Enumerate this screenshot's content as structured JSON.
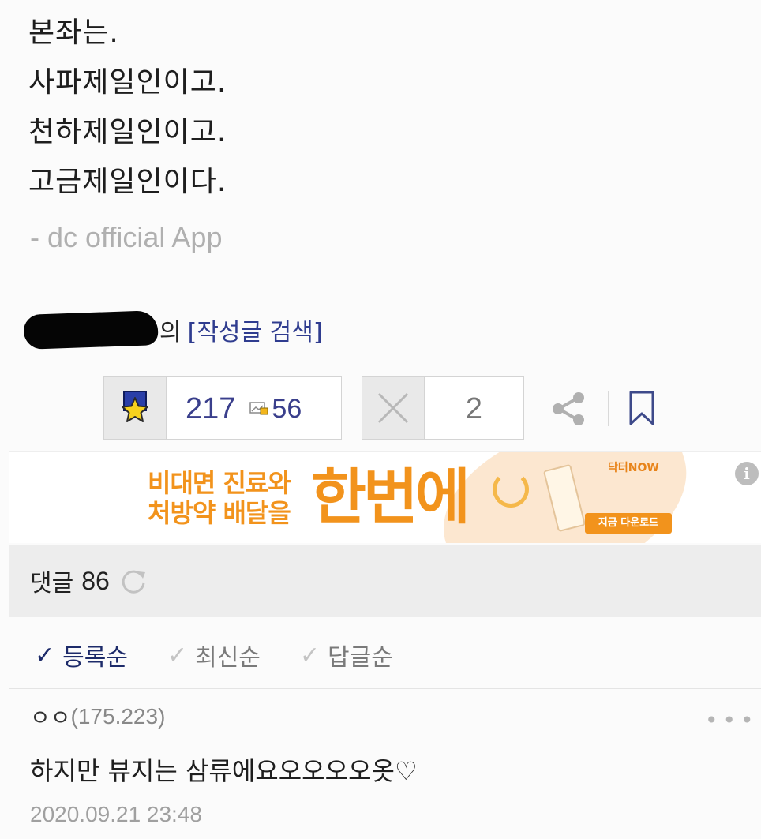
{
  "post": {
    "lines": [
      "본좌는.",
      "사파제일인이고.",
      "천하제일인이고.",
      "고금제일인이다."
    ],
    "signature": "- dc official App"
  },
  "author": {
    "suffix": "의",
    "search_link": "[작성글 검색]"
  },
  "votes": {
    "up_count": "217",
    "fix_count": "56",
    "down_count": "2"
  },
  "ad": {
    "copy_line1": "비대면 진료와",
    "copy_line2": "처방약 배달을",
    "hero": "한번에",
    "brand": "닥터NOW",
    "cta": "지금 다운로드",
    "accent": "#f2931c"
  },
  "comments": {
    "title": "댓글",
    "count": "86",
    "sort": {
      "registered": "등록순",
      "latest": "최신순",
      "replies": "답글순"
    },
    "items": [
      {
        "author": "ㅇㅇ",
        "ip": "(175.223)",
        "text": "하지만 뷰지는 삼류에요오오오오옷♡",
        "date": "2020.09.21 23:48"
      }
    ]
  },
  "colors": {
    "link": "#2f3c8f",
    "vote_count": "#3a3f8c",
    "active_sort": "#1d2b6a"
  },
  "icons": {
    "recommend": "star-badge-icon",
    "fix": "photo-fix-icon",
    "not_recommend": "x-icon",
    "share": "share-icon",
    "bookmark": "bookmark-icon",
    "refresh": "refresh-icon",
    "info": "info-icon",
    "more": "more-dots-icon"
  }
}
